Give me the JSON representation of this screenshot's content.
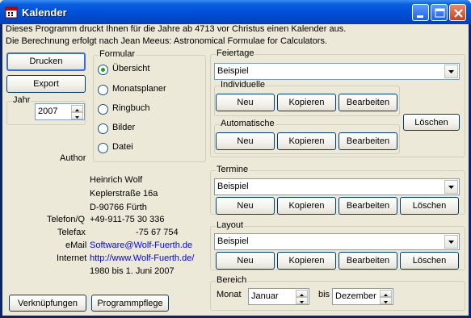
{
  "window": {
    "title": "Kalender"
  },
  "info": {
    "line1": "Dieses Programm druckt Ihnen für die Jahre ab 4713 vor Christus einen Kalender aus.",
    "line2": "Die Berechnung erfolgt nach Jean Meeus: Astronomical Formulae for Calculators."
  },
  "left": {
    "drucken_label": "Drucken",
    "export_label": "Export",
    "jahr_label": "Jahr",
    "jahr_value": "2007",
    "verknuepfungen_label": "Verknüpfungen",
    "programmpflege_label": "Programmpflege"
  },
  "formular": {
    "label": "Formular",
    "options": [
      "Übersicht",
      "Monatsplaner",
      "Ringbuch",
      "Bilder",
      "Datei"
    ],
    "selected": "Übersicht"
  },
  "author": {
    "heading": "Author",
    "name": "Heinrich Wolf",
    "street": "Keplerstraße 16a",
    "city": "D-90766 Fürth",
    "telefon_label": "Telefon/Q",
    "telefon_value": "+49-911-75 30 336",
    "telefax_label": "Telefax",
    "telefax_value": "-75 67 754",
    "email_label": "eMail",
    "email_value": "Software@Wolf-Fuerth.de",
    "internet_label": "Internet",
    "internet_value": "http://www.Wolf-Fuerth.de/",
    "years": "1980 bis 1. Juni 2007"
  },
  "feiertage": {
    "label": "Feiertage",
    "selected": "Beispiel",
    "individuelle_label": "Individuelle",
    "automatische_label": "Automatische",
    "loeschen_label": "Löschen"
  },
  "termine": {
    "label": "Termine",
    "selected": "Beispiel"
  },
  "layout": {
    "label": "Layout",
    "selected": "Beispiel"
  },
  "buttons": {
    "neu": "Neu",
    "kopieren": "Kopieren",
    "bearbeiten": "Bearbeiten",
    "loeschen": "Löschen"
  },
  "bereich": {
    "label": "Bereich",
    "monat_label": "Monat",
    "from_value": "Januar",
    "bis_label": "bis",
    "to_value": "Dezember"
  },
  "colors": {
    "titlebar": "#0054e3",
    "face": "#ece9d8",
    "link": "#0000ff"
  }
}
